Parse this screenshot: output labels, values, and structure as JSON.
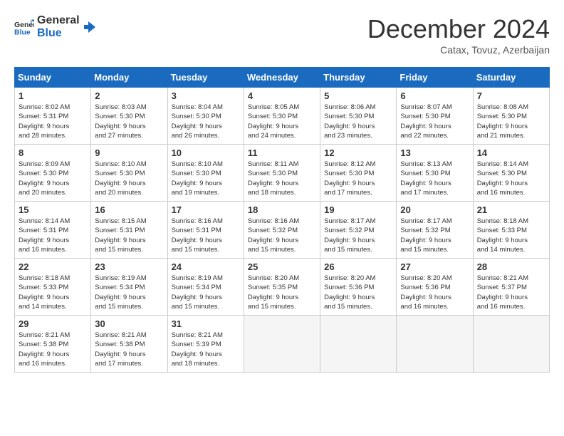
{
  "header": {
    "logo_line1": "General",
    "logo_line2": "Blue",
    "month": "December 2024",
    "location": "Catax, Tovuz, Azerbaijan"
  },
  "weekdays": [
    "Sunday",
    "Monday",
    "Tuesday",
    "Wednesday",
    "Thursday",
    "Friday",
    "Saturday"
  ],
  "weeks": [
    [
      {
        "day": "1",
        "lines": [
          "Sunrise: 8:02 AM",
          "Sunset: 5:31 PM",
          "Daylight: 9 hours",
          "and 28 minutes."
        ]
      },
      {
        "day": "2",
        "lines": [
          "Sunrise: 8:03 AM",
          "Sunset: 5:30 PM",
          "Daylight: 9 hours",
          "and 27 minutes."
        ]
      },
      {
        "day": "3",
        "lines": [
          "Sunrise: 8:04 AM",
          "Sunset: 5:30 PM",
          "Daylight: 9 hours",
          "and 26 minutes."
        ]
      },
      {
        "day": "4",
        "lines": [
          "Sunrise: 8:05 AM",
          "Sunset: 5:30 PM",
          "Daylight: 9 hours",
          "and 24 minutes."
        ]
      },
      {
        "day": "5",
        "lines": [
          "Sunrise: 8:06 AM",
          "Sunset: 5:30 PM",
          "Daylight: 9 hours",
          "and 23 minutes."
        ]
      },
      {
        "day": "6",
        "lines": [
          "Sunrise: 8:07 AM",
          "Sunset: 5:30 PM",
          "Daylight: 9 hours",
          "and 22 minutes."
        ]
      },
      {
        "day": "7",
        "lines": [
          "Sunrise: 8:08 AM",
          "Sunset: 5:30 PM",
          "Daylight: 9 hours",
          "and 21 minutes."
        ]
      }
    ],
    [
      {
        "day": "8",
        "lines": [
          "Sunrise: 8:09 AM",
          "Sunset: 5:30 PM",
          "Daylight: 9 hours",
          "and 20 minutes."
        ]
      },
      {
        "day": "9",
        "lines": [
          "Sunrise: 8:10 AM",
          "Sunset: 5:30 PM",
          "Daylight: 9 hours",
          "and 20 minutes."
        ]
      },
      {
        "day": "10",
        "lines": [
          "Sunrise: 8:10 AM",
          "Sunset: 5:30 PM",
          "Daylight: 9 hours",
          "and 19 minutes."
        ]
      },
      {
        "day": "11",
        "lines": [
          "Sunrise: 8:11 AM",
          "Sunset: 5:30 PM",
          "Daylight: 9 hours",
          "and 18 minutes."
        ]
      },
      {
        "day": "12",
        "lines": [
          "Sunrise: 8:12 AM",
          "Sunset: 5:30 PM",
          "Daylight: 9 hours",
          "and 17 minutes."
        ]
      },
      {
        "day": "13",
        "lines": [
          "Sunrise: 8:13 AM",
          "Sunset: 5:30 PM",
          "Daylight: 9 hours",
          "and 17 minutes."
        ]
      },
      {
        "day": "14",
        "lines": [
          "Sunrise: 8:14 AM",
          "Sunset: 5:30 PM",
          "Daylight: 9 hours",
          "and 16 minutes."
        ]
      }
    ],
    [
      {
        "day": "15",
        "lines": [
          "Sunrise: 8:14 AM",
          "Sunset: 5:31 PM",
          "Daylight: 9 hours",
          "and 16 minutes."
        ]
      },
      {
        "day": "16",
        "lines": [
          "Sunrise: 8:15 AM",
          "Sunset: 5:31 PM",
          "Daylight: 9 hours",
          "and 15 minutes."
        ]
      },
      {
        "day": "17",
        "lines": [
          "Sunrise: 8:16 AM",
          "Sunset: 5:31 PM",
          "Daylight: 9 hours",
          "and 15 minutes."
        ]
      },
      {
        "day": "18",
        "lines": [
          "Sunrise: 8:16 AM",
          "Sunset: 5:32 PM",
          "Daylight: 9 hours",
          "and 15 minutes."
        ]
      },
      {
        "day": "19",
        "lines": [
          "Sunrise: 8:17 AM",
          "Sunset: 5:32 PM",
          "Daylight: 9 hours",
          "and 15 minutes."
        ]
      },
      {
        "day": "20",
        "lines": [
          "Sunrise: 8:17 AM",
          "Sunset: 5:32 PM",
          "Daylight: 9 hours",
          "and 15 minutes."
        ]
      },
      {
        "day": "21",
        "lines": [
          "Sunrise: 8:18 AM",
          "Sunset: 5:33 PM",
          "Daylight: 9 hours",
          "and 14 minutes."
        ]
      }
    ],
    [
      {
        "day": "22",
        "lines": [
          "Sunrise: 8:18 AM",
          "Sunset: 5:33 PM",
          "Daylight: 9 hours",
          "and 14 minutes."
        ]
      },
      {
        "day": "23",
        "lines": [
          "Sunrise: 8:19 AM",
          "Sunset: 5:34 PM",
          "Daylight: 9 hours",
          "and 15 minutes."
        ]
      },
      {
        "day": "24",
        "lines": [
          "Sunrise: 8:19 AM",
          "Sunset: 5:34 PM",
          "Daylight: 9 hours",
          "and 15 minutes."
        ]
      },
      {
        "day": "25",
        "lines": [
          "Sunrise: 8:20 AM",
          "Sunset: 5:35 PM",
          "Daylight: 9 hours",
          "and 15 minutes."
        ]
      },
      {
        "day": "26",
        "lines": [
          "Sunrise: 8:20 AM",
          "Sunset: 5:36 PM",
          "Daylight: 9 hours",
          "and 15 minutes."
        ]
      },
      {
        "day": "27",
        "lines": [
          "Sunrise: 8:20 AM",
          "Sunset: 5:36 PM",
          "Daylight: 9 hours",
          "and 16 minutes."
        ]
      },
      {
        "day": "28",
        "lines": [
          "Sunrise: 8:21 AM",
          "Sunset: 5:37 PM",
          "Daylight: 9 hours",
          "and 16 minutes."
        ]
      }
    ],
    [
      {
        "day": "29",
        "lines": [
          "Sunrise: 8:21 AM",
          "Sunset: 5:38 PM",
          "Daylight: 9 hours",
          "and 16 minutes."
        ]
      },
      {
        "day": "30",
        "lines": [
          "Sunrise: 8:21 AM",
          "Sunset: 5:38 PM",
          "Daylight: 9 hours",
          "and 17 minutes."
        ]
      },
      {
        "day": "31",
        "lines": [
          "Sunrise: 8:21 AM",
          "Sunset: 5:39 PM",
          "Daylight: 9 hours",
          "and 18 minutes."
        ]
      },
      null,
      null,
      null,
      null
    ]
  ]
}
